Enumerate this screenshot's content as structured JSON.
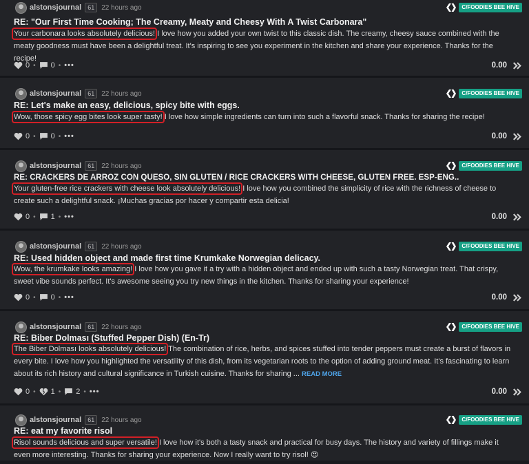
{
  "colors": {
    "background": "#1a1b1f",
    "card": "#222327",
    "badge": "#16a085",
    "highlight": "#d21f26",
    "link": "#4ea3e8"
  },
  "icons": {
    "like": "heart-icon",
    "downvote": "broken-heart-icon",
    "reply": "comment-icon",
    "more": "more-icon",
    "community": "hive-logo-icon",
    "vote": "upvote-chevron-icon"
  },
  "posts": [
    {
      "author": "alstonsjournal",
      "rep": "61",
      "time": "22 hours ago",
      "community": "C/FOODIES BEE HIVE",
      "title": "RE: \"Our First Time Cooking; The Creamy, Meaty and Cheesy With A Twist Carbonara\"",
      "highlight": "Your carbonara looks absolutely delicious!",
      "rest": " I love how you added your own twist to this classic dish. The creamy, cheesy sauce combined with the meaty goodness must have been a delightful treat. It's inspiring to see you experiment in the kitchen and share your experience. Thanks for the recipe!",
      "likes": "0",
      "comments": "0",
      "payout": "0.00"
    },
    {
      "author": "alstonsjournal",
      "rep": "61",
      "time": "22 hours ago",
      "community": "C/FOODIES BEE HIVE",
      "title": "RE: Let's make an easy, delicious, spicy bite with eggs.",
      "highlight": "Wow, those spicy egg bites look super tasty!",
      "rest": " I love how simple ingredients can turn into such a flavorful snack. Thanks for sharing the recipe!",
      "likes": "0",
      "comments": "0",
      "payout": "0.00"
    },
    {
      "author": "alstonsjournal",
      "rep": "61",
      "time": "22 hours ago",
      "community": "C/FOODIES BEE HIVE",
      "title": "RE: CRACKERS DE ARROZ CON QUESO, SIN GLUTEN / RICE CRACKERS WITH CHEESE, GLUTEN FREE. ESP-ENG..",
      "highlight": "Your gluten-free rice crackers with cheese look absolutely delicious!",
      "rest": " I love how you combined the simplicity of rice with the richness of cheese to create such a delightful snack. ¡Muchas gracias por hacer y compartir esta delicia!",
      "likes": "0",
      "comments": "1",
      "payout": "0.00"
    },
    {
      "author": "alstonsjournal",
      "rep": "61",
      "time": "22 hours ago",
      "community": "C/FOODIES BEE HIVE",
      "title": "RE: Used hidden object and made first time Krumkake Norwegian delicacy.",
      "highlight": "Wow, the krumkake looks amazing!",
      "rest": " I love how you gave it a try with a hidden object and ended up with such a tasty Norwegian treat. That crispy, sweet vibe sounds perfect. It's awesome seeing you try new things in the kitchen. Thanks for sharing your experience!",
      "likes": "0",
      "comments": "0",
      "payout": "0.00"
    },
    {
      "author": "alstonsjournal",
      "rep": "61",
      "time": "22 hours ago",
      "community": "C/FOODIES BEE HIVE",
      "title": "RE: Biber Dolması (Stuffed Pepper Dish) (En-Tr)",
      "highlight": "The Biber Dolması looks absolutely delicious!",
      "rest": " The combination of rice, herbs, and spices stuffed into tender peppers must create a burst of flavors in every bite. I love how you highlighted the versatility of this dish, from its vegetarian roots to the option of adding ground meat. It's fascinating to learn about its rich history and cultural significance in Turkish cuisine. Thanks for sharing ...",
      "read_more": "READ MORE",
      "likes": "0",
      "downvotes": "1",
      "comments": "2",
      "payout": "0.00"
    },
    {
      "author": "alstonsjournal",
      "rep": "61",
      "time": "22 hours ago",
      "community": "C/FOODIES BEE HIVE",
      "title": "RE: eat my favorite risol",
      "highlight": "Risol sounds delicious and super versatile!",
      "rest": " I love how it's both a tasty snack and practical for busy days. The history and variety of fillings make it even more interesting. Thanks for sharing your experience. Now I really want to try risol! 😍"
    }
  ]
}
